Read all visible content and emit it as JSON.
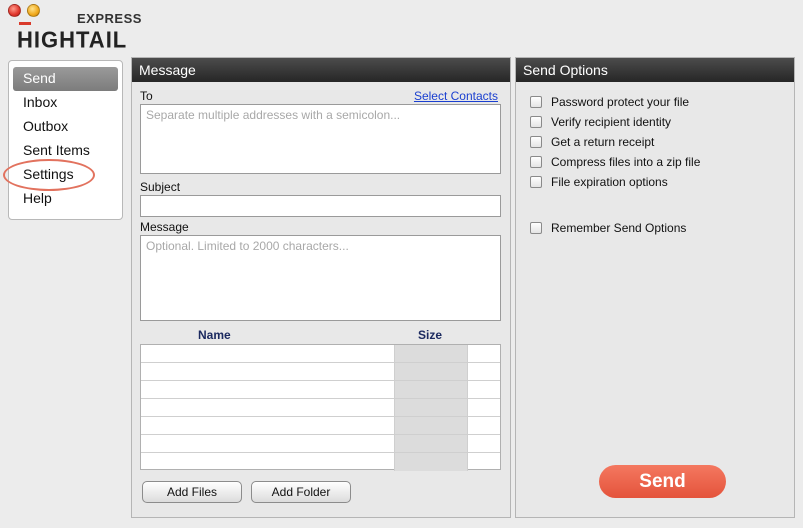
{
  "window": {
    "controls": [
      "close",
      "minimize"
    ]
  },
  "logo": {
    "express": "EXPRESS",
    "main": "HIGHTAIL"
  },
  "sidebar": {
    "items": [
      {
        "label": "Send",
        "active": true
      },
      {
        "label": "Inbox",
        "active": false
      },
      {
        "label": "Outbox",
        "active": false
      },
      {
        "label": "Sent Items",
        "active": false
      },
      {
        "label": "Settings",
        "active": false,
        "circled": true
      },
      {
        "label": "Help",
        "active": false
      }
    ]
  },
  "message": {
    "title": "Message",
    "to_label": "To",
    "select_contacts": "Select Contacts",
    "to_placeholder": "Separate multiple addresses with a semicolon...",
    "subject_label": "Subject",
    "subject_value": "",
    "message_label": "Message",
    "message_placeholder": "Optional. Limited to 2000 characters...",
    "file_table": {
      "columns": [
        "Name",
        "Size"
      ],
      "rows": 7
    },
    "add_files": "Add Files",
    "add_folder": "Add Folder"
  },
  "send_options": {
    "title": "Send Options",
    "options": [
      {
        "label": "Password protect your file",
        "checked": false
      },
      {
        "label": "Verify recipient identity",
        "checked": false
      },
      {
        "label": "Get a return receipt",
        "checked": false
      },
      {
        "label": "Compress files into a zip file",
        "checked": false
      },
      {
        "label": "File expiration options",
        "checked": false
      }
    ],
    "remember": {
      "label": "Remember Send Options",
      "checked": false
    },
    "send_button": "Send"
  },
  "colors": {
    "accent": "#e4533b",
    "link": "#1a3fd0",
    "header": "#262626",
    "highlight_ring": "#e2725e"
  }
}
